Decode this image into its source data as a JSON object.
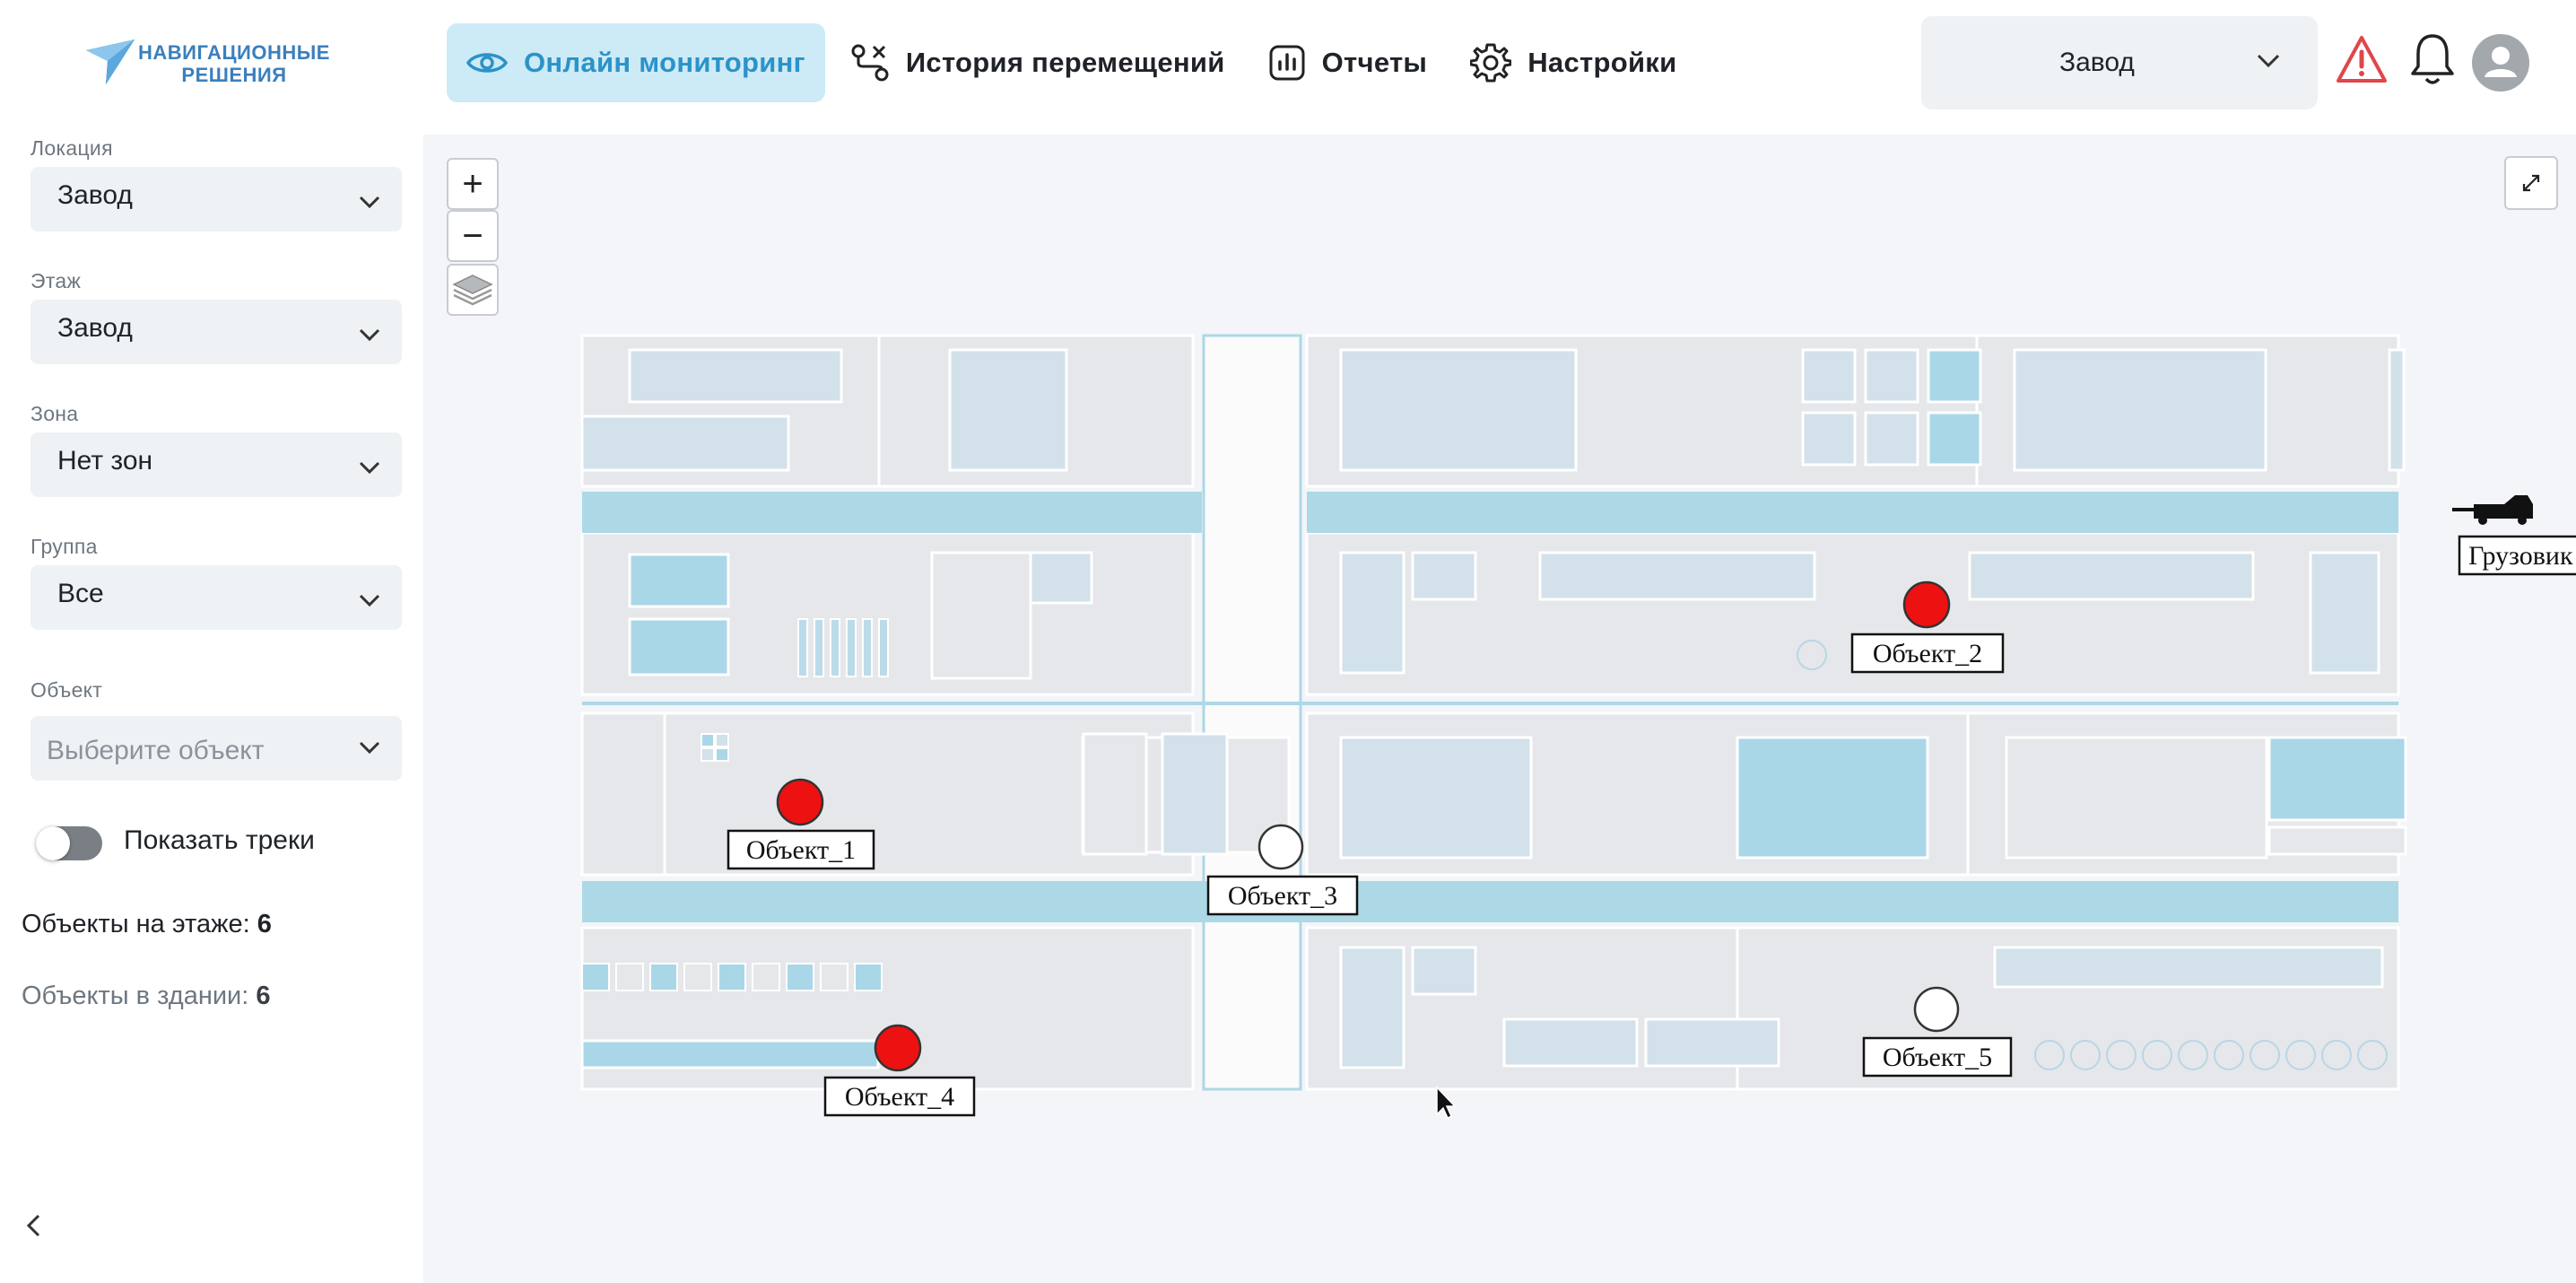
{
  "header": {
    "logo_text_line1": "НАВИГАЦИОННЫЕ",
    "logo_text_line2": "РЕШЕНИЯ",
    "nav": [
      {
        "label": "Онлайн мониторинг",
        "icon": "eye-icon",
        "active": true
      },
      {
        "label": "История перемещений",
        "icon": "route-icon",
        "active": false
      },
      {
        "label": "Отчеты",
        "icon": "chart-icon",
        "active": false
      },
      {
        "label": "Настройки",
        "icon": "gear-icon",
        "active": false
      }
    ],
    "location_select": {
      "value": "Завод"
    },
    "icons": [
      "alert-icon",
      "bell-icon",
      "user-avatar-icon"
    ],
    "alert_color": "#e0464b"
  },
  "sidebar": {
    "location": {
      "label": "Локация",
      "value": "Завод"
    },
    "floor": {
      "label": "Этаж",
      "value": "Завод"
    },
    "zone": {
      "label": "Зона",
      "value": "Нет зон"
    },
    "group": {
      "label": "Группа",
      "value": "Все"
    },
    "object": {
      "label": "Объект",
      "placeholder": "Выберите объект"
    },
    "show_tracks": {
      "label": "Показать треки",
      "enabled": false
    },
    "objects_on_floor": {
      "label": "Объекты на этаже:",
      "value": "6"
    },
    "objects_in_building": {
      "label": "Объекты в здании:",
      "value": "6"
    }
  },
  "map": {
    "controls": {
      "zoom_in": "+",
      "zoom_out": "−"
    },
    "markers": [
      {
        "label": "Объект_1",
        "status": "alarm"
      },
      {
        "label": "Объект_2",
        "status": "alarm"
      },
      {
        "label": "Объект_3",
        "status": "normal"
      },
      {
        "label": "Объект_4",
        "status": "alarm"
      },
      {
        "label": "Объект_5",
        "status": "normal"
      },
      {
        "label": "Грузовик",
        "status": "vehicle"
      }
    ],
    "colors": {
      "alarm": "#ee1111",
      "normal": "#ffffff",
      "road": "#add8e6",
      "building": "#e6e7ea"
    }
  }
}
